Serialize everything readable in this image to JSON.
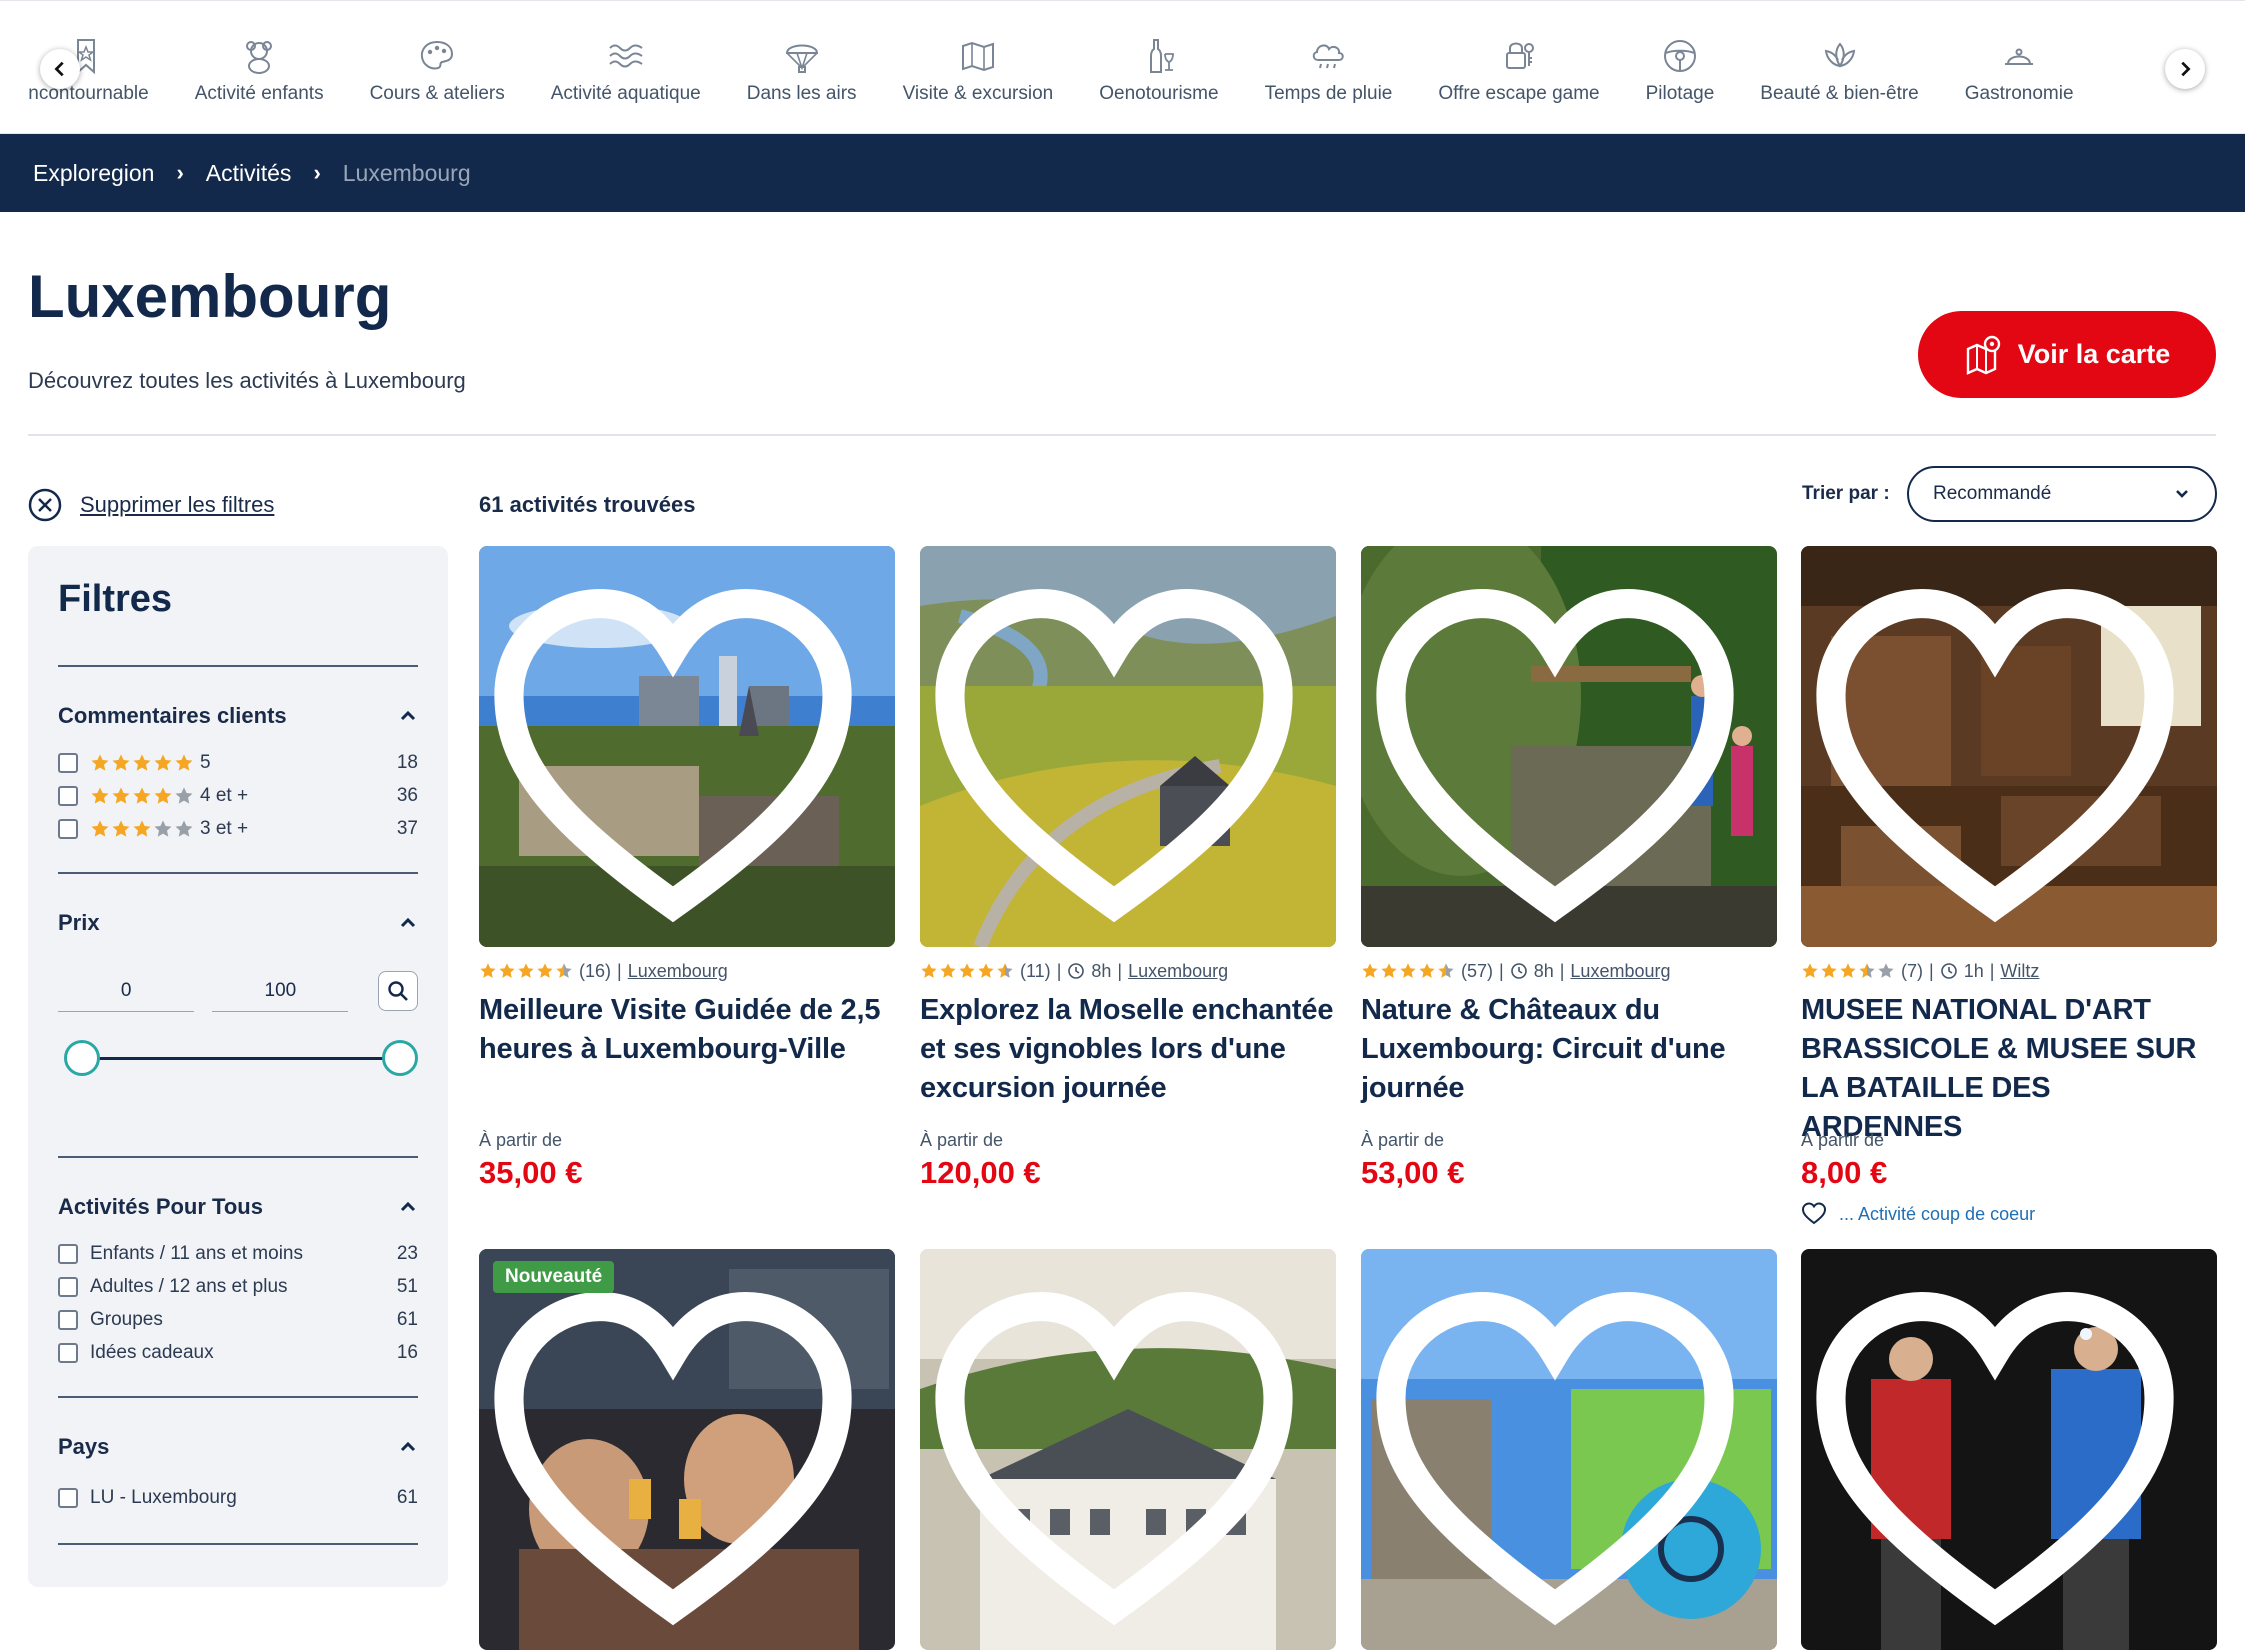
{
  "categories": [
    {
      "label": "Incontournable",
      "icon": "bookmark-star-icon"
    },
    {
      "label": "Activité enfants",
      "icon": "teddy-bear-icon"
    },
    {
      "label": "Cours & ateliers",
      "icon": "palette-icon"
    },
    {
      "label": "Activité aquatique",
      "icon": "waves-icon"
    },
    {
      "label": "Dans les airs",
      "icon": "parachute-icon"
    },
    {
      "label": "Visite & excursion",
      "icon": "map-icon"
    },
    {
      "label": "Oenotourisme",
      "icon": "wine-bottle-icon"
    },
    {
      "label": "Temps de pluie",
      "icon": "rain-cloud-icon"
    },
    {
      "label": "Offre escape game",
      "icon": "lock-icon"
    },
    {
      "label": "Pilotage",
      "icon": "steering-wheel-icon"
    },
    {
      "label": "Beauté & bien-être",
      "icon": "lotus-icon"
    },
    {
      "label": "Gastronomie",
      "icon": "cloche-icon"
    }
  ],
  "breadcrumb": {
    "items": [
      "Exploregion",
      "Activités"
    ],
    "current": "Luxembourg"
  },
  "page": {
    "title": "Luxembourg",
    "subtitle": "Découvrez toutes les activités à Luxembourg",
    "map_button": "Voir la carte",
    "clear_filters": "Supprimer les filtres",
    "results_count": "61 activités trouvées",
    "sort_label": "Trier par :",
    "sort_value": "Recommandé"
  },
  "filters": {
    "title": "Filtres",
    "reviews": {
      "title": "Commentaires clients",
      "options": [
        {
          "stars": 5,
          "label": "5",
          "count": "18"
        },
        {
          "stars": 4,
          "label": "4 et +",
          "count": "36"
        },
        {
          "stars": 3,
          "label": "3 et +",
          "count": "37"
        }
      ]
    },
    "price": {
      "title": "Prix",
      "min": "0",
      "max": "100"
    },
    "audience": {
      "title": "Activités Pour Tous",
      "options": [
        {
          "label": "Enfants / 11 ans et moins",
          "count": "23"
        },
        {
          "label": "Adultes / 12 ans et plus",
          "count": "51"
        },
        {
          "label": "Groupes",
          "count": "61"
        },
        {
          "label": "Idées cadeaux",
          "count": "16"
        }
      ]
    },
    "country": {
      "title": "Pays",
      "options": [
        {
          "label": "LU - Luxembourg",
          "count": "61"
        }
      ]
    }
  },
  "activities": [
    {
      "rating": 4.5,
      "reviews": "(16)",
      "duration": "",
      "location": "Luxembourg",
      "title": "Meilleure Visite Guidée de 2,5 heures à Luxembourg-Ville",
      "from": "À partir de",
      "price": "35,00 €",
      "badge": "",
      "coup": ""
    },
    {
      "rating": 4.5,
      "reviews": "(11)",
      "duration": "8h",
      "location": "Luxembourg",
      "title": "Explorez la Moselle enchantée et ses vignobles lors d'une excursion journée",
      "from": "À partir de",
      "price": "120,00 €",
      "badge": "",
      "coup": ""
    },
    {
      "rating": 4.5,
      "reviews": "(57)",
      "duration": "8h",
      "location": "Luxembourg",
      "title": "Nature & Châteaux du Luxembourg: Circuit d'une journée",
      "from": "À partir de",
      "price": "53,00 €",
      "badge": "",
      "coup": ""
    },
    {
      "rating": 3.5,
      "reviews": "(7)",
      "duration": "1h",
      "location": "Wiltz",
      "title": "MUSEE NATIONAL D'ART BRASSICOLE & MUSEE SUR LA BATAILLE DES ARDENNES",
      "from": "À partir de",
      "price": "8,00 €",
      "badge": "",
      "coup": "... Activité coup de coeur"
    },
    {
      "badge": "Nouveauté"
    },
    {
      "badge": ""
    },
    {
      "badge": ""
    },
    {
      "badge": ""
    }
  ],
  "colors": {
    "navy": "#13294b",
    "red": "#e30613",
    "star": "#f5a623",
    "teal": "#2aa8a5",
    "green_badge": "#3f9b45"
  }
}
